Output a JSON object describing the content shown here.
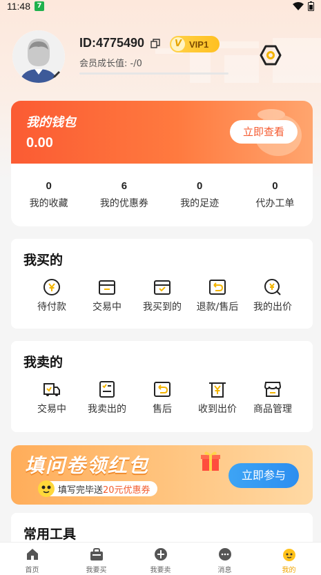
{
  "status": {
    "time": "11:48",
    "badge": "7"
  },
  "profile": {
    "id_text": "ID:4775490",
    "vip_label": "VIP1",
    "vip_badge": "V",
    "growth_text": "会员成长值: -/0",
    "growth_progress": 0
  },
  "wallet": {
    "title": "我的钱包",
    "amount": "0.00",
    "button": "立即查看"
  },
  "stats": [
    {
      "value": "0",
      "label": "我的收藏"
    },
    {
      "value": "6",
      "label": "我的优惠券"
    },
    {
      "value": "0",
      "label": "我的足迹"
    },
    {
      "value": "0",
      "label": "代办工单"
    }
  ],
  "buy": {
    "title": "我买的",
    "items": [
      {
        "label": "待付款",
        "icon": "yen-coin-icon"
      },
      {
        "label": "交易中",
        "icon": "box-icon"
      },
      {
        "label": "我买到的",
        "icon": "check-box-icon"
      },
      {
        "label": "退款/售后",
        "icon": "return-icon"
      },
      {
        "label": "我的出价",
        "icon": "bid-icon"
      }
    ]
  },
  "sell": {
    "title": "我卖的",
    "items": [
      {
        "label": "交易中",
        "icon": "truck-icon"
      },
      {
        "label": "我卖出的",
        "icon": "list-icon"
      },
      {
        "label": "售后",
        "icon": "return-icon"
      },
      {
        "label": "收到出价",
        "icon": "yen-receipt-icon"
      },
      {
        "label": "商品管理",
        "icon": "store-icon"
      }
    ]
  },
  "banner": {
    "title": "填问卷领红包",
    "sub_prefix": "填写完毕送",
    "sub_highlight": "20元优惠券",
    "button": "立即参与"
  },
  "tools": {
    "title": "常用工具"
  },
  "tabs": [
    {
      "label": "首页",
      "icon": "home-icon",
      "active": false
    },
    {
      "label": "我要买",
      "icon": "bag-icon",
      "active": false
    },
    {
      "label": "我要卖",
      "icon": "sell-icon",
      "active": false
    },
    {
      "label": "消息",
      "icon": "message-icon",
      "active": false
    },
    {
      "label": "我的",
      "icon": "mine-icon",
      "active": true
    }
  ],
  "colors": {
    "accent": "#fb5b33",
    "vip": "#ffc021",
    "tab_active": "#f0a500",
    "banner_button": "#2c8ef0"
  }
}
